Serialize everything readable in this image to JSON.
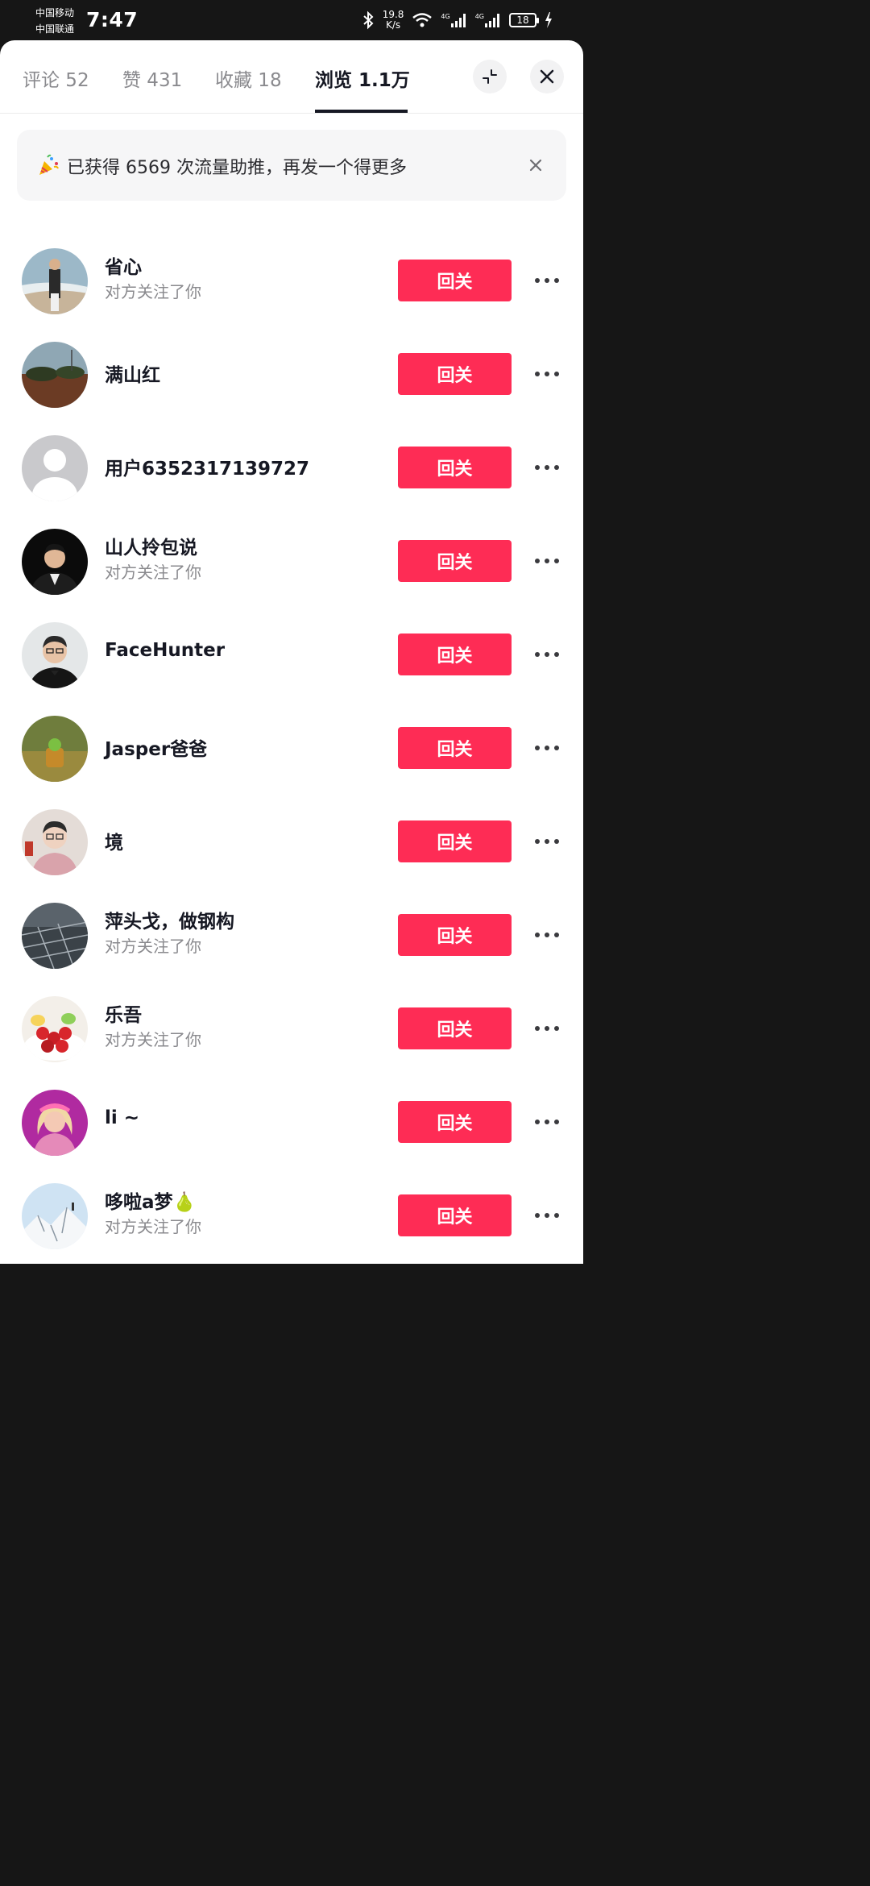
{
  "status_bar": {
    "carrier_1": "中国移动",
    "carrier_2": "中国联通",
    "time": "7:47",
    "speed_value": "19.8",
    "speed_unit": "K/s",
    "network_1": "4G",
    "network_2": "4G",
    "battery": "18"
  },
  "tabs": [
    {
      "label": "评论 52"
    },
    {
      "label": "赞 431"
    },
    {
      "label": "收藏 18"
    },
    {
      "label": "浏览 1.1万",
      "active": true
    }
  ],
  "header_icons": {
    "collapse": "collapse-icon",
    "close": "close-icon"
  },
  "banner": {
    "icon": "party-popper-icon",
    "text": "已获得 6569 次流量助推，再发一个得更多"
  },
  "follow_back_label": "回关",
  "users": [
    {
      "name": "省心",
      "subtitle": "对方关注了你"
    },
    {
      "name": "满山红",
      "subtitle": ""
    },
    {
      "name": "用户6352317139727",
      "subtitle": ""
    },
    {
      "name": "山人拎包说",
      "subtitle": "对方关注了你"
    },
    {
      "name": "FaceHunter",
      "subtitle": ""
    },
    {
      "name": "Jasper爸爸",
      "subtitle": ""
    },
    {
      "name": "境",
      "subtitle": ""
    },
    {
      "name": "萍头戈，做钢构",
      "subtitle": "对方关注了你"
    },
    {
      "name": "乐吾",
      "subtitle": "对方关注了你"
    },
    {
      "name": "li ~",
      "subtitle": ""
    },
    {
      "name": "哆啦a梦🍐",
      "subtitle": "对方关注了你"
    }
  ],
  "colors": {
    "accent": "#fe2c55",
    "text_primary": "#161823",
    "text_secondary": "#8a8a8e"
  }
}
